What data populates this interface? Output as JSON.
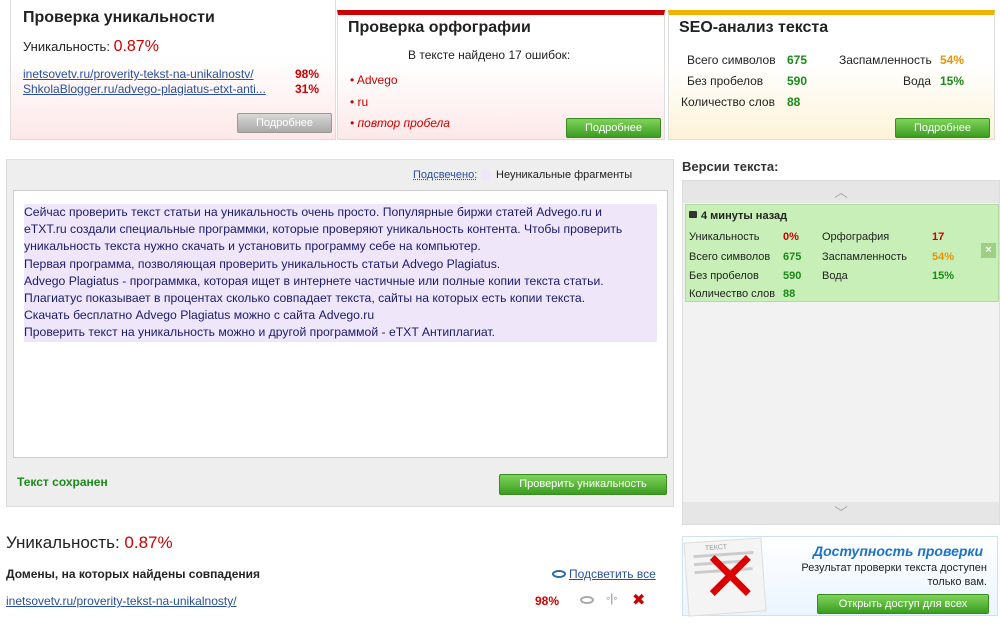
{
  "uniq_card": {
    "title": "Проверка уникальности",
    "uniq_label": "Уникальность:",
    "uniq_value": "0.87%",
    "links": [
      {
        "url": "inetsovetv.ru/proverity-tekst-na-unikalnostv/",
        "pct": "98%"
      },
      {
        "url": "ShkolaBlogger.ru/advego-plagiatus-etxt-anti...",
        "pct": "31%"
      }
    ],
    "button": "Подробнее"
  },
  "spell_card": {
    "title": "Проверка орфографии",
    "found": "В тексте найдено 17 ошибок:",
    "items": [
      "Advego",
      "ru",
      "повтор пробела"
    ],
    "button": "Подробнее"
  },
  "seo_card": {
    "title": "SEO-анализ текста",
    "rows": [
      {
        "l": "Всего символов",
        "v": "675",
        "l2": "Заспамленность",
        "v2": "54%"
      },
      {
        "l": "Без пробелов",
        "v": "590",
        "l2": "Вода",
        "v2": "15%"
      },
      {
        "l": "Количество слов",
        "v": "88"
      }
    ],
    "button": "Подробнее"
  },
  "editor": {
    "highlight_label": "Подсвечено:",
    "legend": "Неуникальные фрагменты",
    "lines": [
      "Сейчас проверить текст статьи на уникальность очень просто.  Популярные биржи статей Advego.ru  и",
      "eTXT.ru создали специальные программки, которые проверяют уникальность контента. Чтобы проверить",
      "уникальность текста нужно скачать и установить программу себе на компьютер.",
      "Первая программа, позволяющая проверить уникальность статьи Advego Plagiatus.",
      "Advego Plagiatus - программка, которая ищет  в интернете частичные или полные копии текста статьи.",
      "Плагиатус показывает в процентах сколько совпадает текста, сайты на которых есть копии текста.",
      "Скачать бесплатно Advego Plagiatus можно с сайта Advego.ru",
      "Проверить текст на уникальность можно и другой программой - eTXT Антиплагиат."
    ],
    "saved": "Текст сохранен",
    "check_button": "Проверить уникальность"
  },
  "versions": {
    "title": "Версии текста:",
    "time": "4 минуты назад",
    "rows": [
      {
        "l": "Уникальность",
        "v": "0%",
        "l2": "Орфография",
        "v2": "17"
      },
      {
        "l": "Всего символов",
        "v": "675",
        "l2": "Заспамленность",
        "v2": "54%"
      },
      {
        "l": "Без пробелов",
        "v": "590",
        "l2": "Вода",
        "v2": "15%"
      },
      {
        "l": "Количество слов",
        "v": "88"
      }
    ]
  },
  "bottom": {
    "uniq_label": "Уникальность:",
    "uniq_value": "0.87%",
    "domains_title": "Домены, на которых найдены совпадения",
    "highlight_all": "Подсветить все",
    "domain": "inetsovetv.ru/proverity-tekst-na-unikalnosty/",
    "domain_pct": "98%"
  },
  "access": {
    "title": "Доступность проверки",
    "text1": "Результат проверки текста доступен",
    "text2": "только вам.",
    "button": "Открыть доступ для всех",
    "stamp": "ТЕКСТ"
  }
}
